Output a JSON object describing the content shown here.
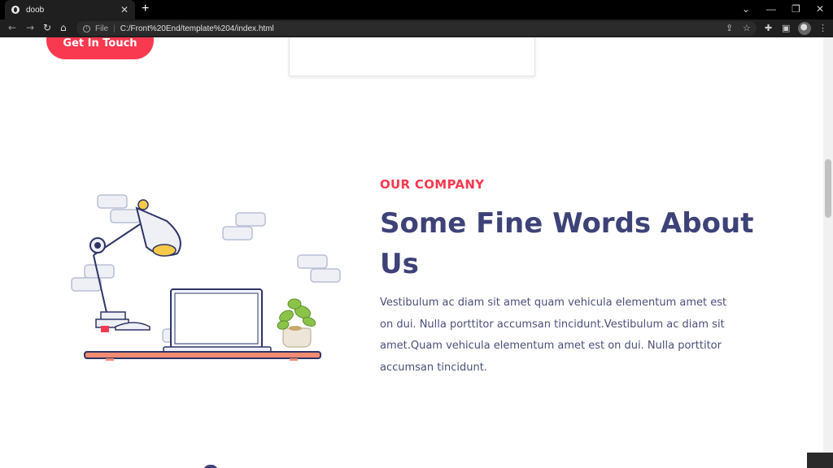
{
  "browser": {
    "tab_title": "doob",
    "tab_close": "✕",
    "new_tab": "+",
    "address_file_label": "File",
    "address_url": "C:/Front%20End/template%204/index.html",
    "icons": [
      "globe-icon",
      "back-icon",
      "forward-icon",
      "reload-icon",
      "home-icon",
      "info-icon",
      "share-icon",
      "star-icon",
      "extensions-icon",
      "sidebar-icon",
      "profile-avatar",
      "menu-icon",
      "minimize-icon",
      "restore-icon",
      "close-icon"
    ]
  },
  "page": {
    "cta_label": "Get In Touch",
    "kicker": "OUR COMPANY",
    "heading": "Some Fine Words About Us",
    "body": "Vestibulum ac diam sit amet quam vehicula elementum amet est on dui. Nulla porttitor accumsan tincidunt.Vestibulum ac diam sit amet.Quam vehicula elementum amet est on dui. Nulla porttitor accumsan tincidunt."
  },
  "colors": {
    "accent": "#f9394f",
    "heading": "#3d4278",
    "body_text": "#4b4f7a",
    "illustration_outline": "#2e3566",
    "lamp_yellow": "#f7c948",
    "plant_green": "#8bc34a",
    "desk_top": "#f28c70"
  }
}
